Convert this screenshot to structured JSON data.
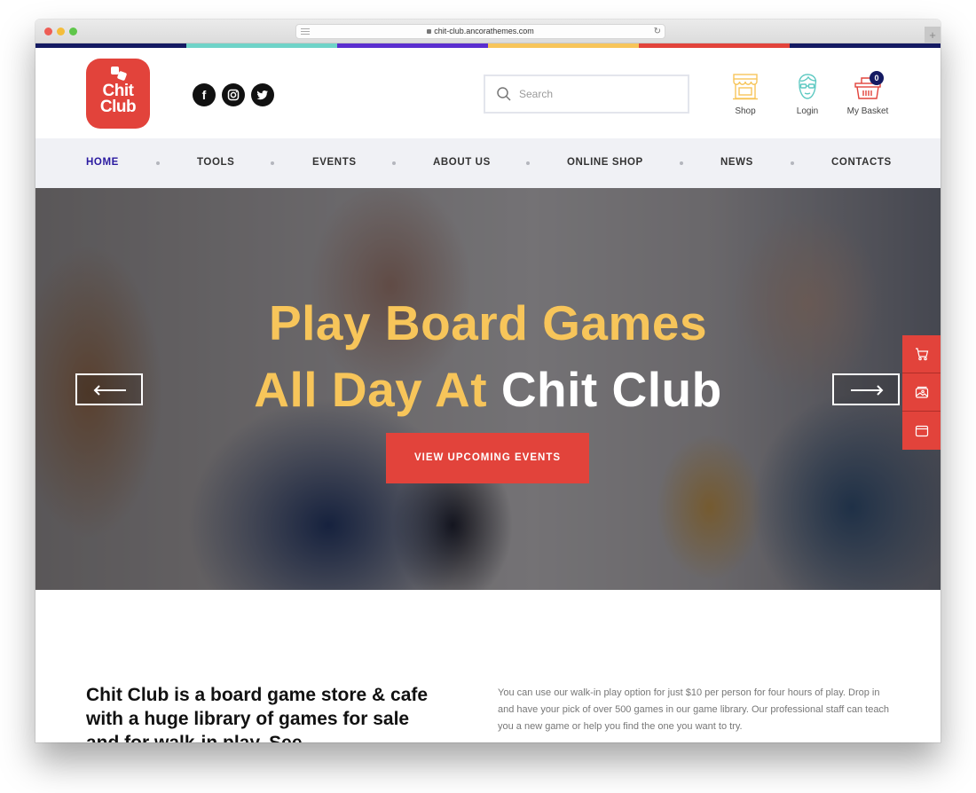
{
  "browser": {
    "url": "chit-club.ancorathemes.com"
  },
  "colorbar": [
    "#141a62",
    "#6fd3c8",
    "#5a2ecf",
    "#f7c55a",
    "#e2433b",
    "#141a62"
  ],
  "brand": {
    "logo_line1": "Chit",
    "logo_line2": "Club",
    "accent": "#e2433b",
    "yellow": "#f7c55a",
    "navy": "#141a62"
  },
  "socials": [
    {
      "name": "facebook",
      "glyph": "f"
    },
    {
      "name": "instagram"
    },
    {
      "name": "twitter"
    }
  ],
  "search": {
    "placeholder": "Search",
    "value": ""
  },
  "header_icons": {
    "shop_label": "Shop",
    "login_label": "Login",
    "basket_label": "My Basket",
    "basket_count": "0"
  },
  "nav": {
    "items": [
      {
        "label": "Home",
        "active": true
      },
      {
        "label": "Tools"
      },
      {
        "label": "Events"
      },
      {
        "label": "About Us"
      },
      {
        "label": "Online Shop"
      },
      {
        "label": "News"
      },
      {
        "label": "Contacts"
      }
    ]
  },
  "hero": {
    "line1": "Play Board Games",
    "line2_yellow": "All Day At ",
    "line2_white": "Chit Club",
    "cta_label": "View Upcoming Events"
  },
  "intro": {
    "title": "Chit Club is a board game store & cafe with a huge library of games for sale and for walk-in play. See",
    "text": "You can use our walk-in play option for just $10 per person for four hours of play. Drop in and have your pick of over 500 games in our game library. Our professional staff can teach you a new game or help you find the one you want to try."
  }
}
